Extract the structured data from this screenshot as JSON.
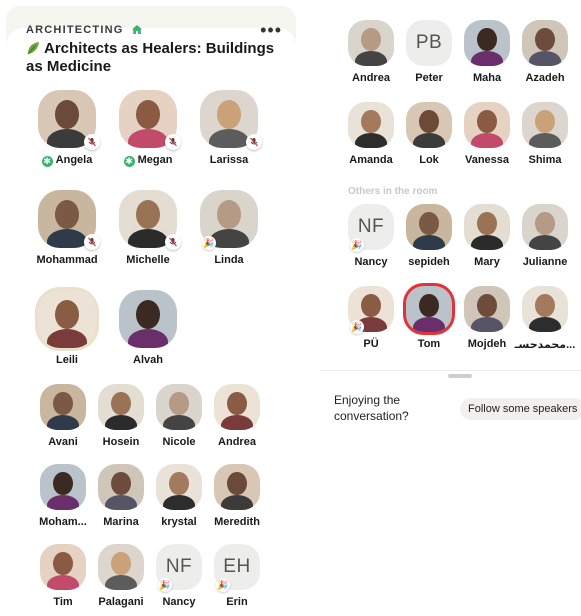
{
  "room": {
    "club": "ARCHITECTING",
    "title": "Architects as Healers: Buildings as Medicine",
    "more_glyph": "•••"
  },
  "icons": {
    "club": "house-icon",
    "title": "leaf-icon",
    "more": "more-dots-icon",
    "muted": "mic-off-icon",
    "moderator": "moderator-star-icon",
    "new_member": "party-popper-icon"
  },
  "colors": {
    "page_bg": "#f6f5ef",
    "moderator_badge": "#3cb371",
    "live_ring": "#e0333a",
    "label_gray": "#c9c9c4"
  },
  "stage": [
    {
      "name": "Angela",
      "moderator": true,
      "muted": true
    },
    {
      "name": "Megan",
      "moderator": true,
      "muted": true
    },
    {
      "name": "Larissa",
      "moderator": false,
      "muted": true
    },
    {
      "name": "Mohammad",
      "moderator": false,
      "muted": true
    },
    {
      "name": "Michelle",
      "moderator": false,
      "muted": true
    },
    {
      "name": "Linda",
      "moderator": false,
      "muted": false,
      "new": true
    },
    {
      "name": "Leili",
      "moderator": false,
      "muted": false
    },
    {
      "name": "Alvah",
      "moderator": false,
      "muted": false
    }
  ],
  "followed_by_speakers_a": [
    {
      "name": "Avani"
    },
    {
      "name": "Hosein"
    },
    {
      "name": "Nicole"
    },
    {
      "name": "Andrea"
    },
    {
      "name": "Moham..."
    },
    {
      "name": "Marina"
    },
    {
      "name": "krystal"
    },
    {
      "name": "Meredith"
    },
    {
      "name": "Tim"
    },
    {
      "name": "Palagani"
    },
    {
      "name": "Nancy",
      "initials": "NF",
      "new": true
    },
    {
      "name": "Erin",
      "initials": "EH",
      "new": true
    }
  ],
  "followed_by_speakers_b": [
    {
      "name": "Andrea"
    },
    {
      "name": "Peter",
      "initials": "PB"
    },
    {
      "name": "Maha"
    },
    {
      "name": "Azadeh"
    },
    {
      "name": "Amanda"
    },
    {
      "name": "Lok"
    },
    {
      "name": "Vanessa"
    },
    {
      "name": "Shima"
    }
  ],
  "others_label": "Others in the room",
  "others": [
    {
      "name": "Nancy",
      "initials": "NF",
      "new": true
    },
    {
      "name": "sepideh"
    },
    {
      "name": "Mary"
    },
    {
      "name": "Julianne"
    },
    {
      "name": "PÜ",
      "new": true
    },
    {
      "name": "Tom"
    },
    {
      "name": "Mojdeh"
    },
    {
      "name": "محمدحسـ..."
    }
  ],
  "footer": {
    "prompt": "Enjoying the conversation?",
    "button": "Follow some speakers"
  }
}
